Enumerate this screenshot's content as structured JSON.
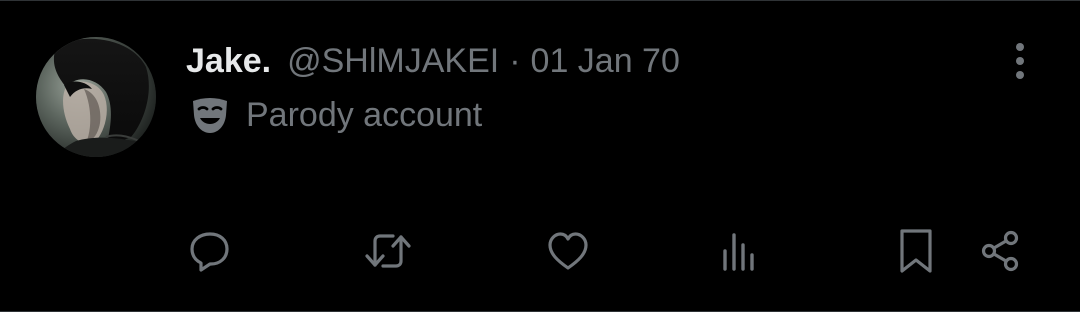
{
  "tweet": {
    "display_name": "Jake.",
    "handle": "@SHlMJAKEI",
    "separator": "·",
    "timestamp": "01 Jan 70",
    "label": "Parody account"
  },
  "icons": {
    "more": "more-vertical-icon",
    "label": "theater-mask-icon",
    "reply": "reply-icon",
    "retweet": "retweet-icon",
    "like": "heart-icon",
    "views": "analytics-icon",
    "bookmark": "bookmark-icon",
    "share": "share-icon"
  },
  "colors": {
    "background": "#000000",
    "primary_text": "#e7e9ea",
    "secondary_text": "#71767b",
    "border": "#2f3336"
  }
}
